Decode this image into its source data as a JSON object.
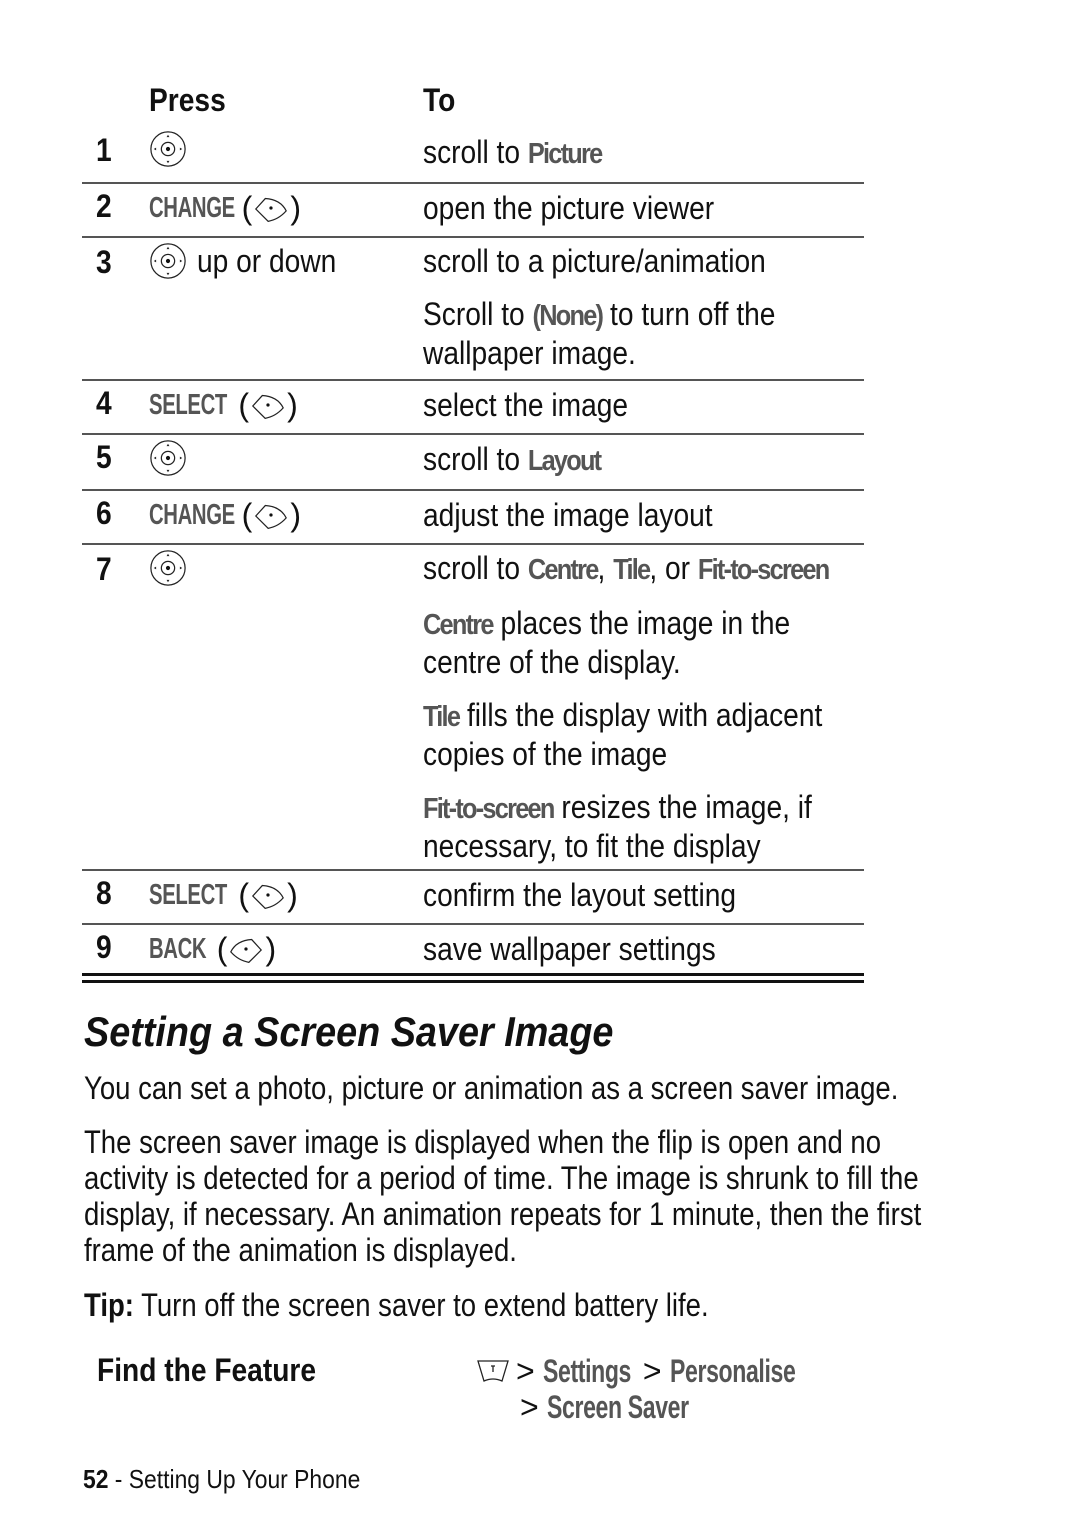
{
  "table": {
    "header": {
      "press": "Press",
      "to": "To"
    },
    "rows": [
      {
        "num": "1",
        "key_icon": "nav-key-icon",
        "key_label": "",
        "key_suffix": "",
        "desc": [
          {
            "text": "scroll to ",
            "menu": "Picture"
          }
        ]
      },
      {
        "num": "2",
        "key_icon": "right-soft-key-icon",
        "key_label": "CHANGE",
        "desc": [
          {
            "text": "open the picture viewer"
          }
        ]
      },
      {
        "num": "3",
        "key_icon": "nav-key-icon",
        "key_suffix": "up or down",
        "desc": [
          {
            "text": "scroll to a picture/animation"
          },
          {
            "pre": "Scroll to ",
            "menu": "(None)",
            "post": " to turn off the wallpaper image."
          }
        ]
      },
      {
        "num": "4",
        "key_icon": "right-soft-key-icon",
        "key_label": "SELECT",
        "desc": [
          {
            "text": "select the image"
          }
        ]
      },
      {
        "num": "5",
        "key_icon": "nav-key-icon",
        "desc": [
          {
            "text": "scroll to ",
            "menu": "Layout"
          }
        ]
      },
      {
        "num": "6",
        "key_icon": "right-soft-key-icon",
        "key_label": "CHANGE",
        "desc": [
          {
            "text": "adjust the image layout"
          }
        ]
      },
      {
        "num": "7",
        "key_icon": "nav-key-icon",
        "desc": [
          {
            "pre": "scroll to ",
            "m1": "Centre",
            "s1": ", ",
            "m2": "Tile",
            "s2": ", or ",
            "m3": "Fit-to-screen"
          },
          {
            "menu": "Centre",
            "post": " places the image in the centre of the display."
          },
          {
            "menu": "Tile",
            "post": " fills the display with adjacent copies of the image"
          },
          {
            "menu": "Fit-to-screen",
            "post": " resizes the image, if necessary, to fit the display"
          }
        ]
      },
      {
        "num": "8",
        "key_icon": "right-soft-key-icon",
        "key_label": "SELECT",
        "desc": [
          {
            "text": "confirm the layout setting"
          }
        ]
      },
      {
        "num": "9",
        "key_icon": "left-soft-key-icon",
        "key_label": "BACK",
        "desc": [
          {
            "text": "save wallpaper settings"
          }
        ]
      }
    ]
  },
  "section": {
    "title": "Setting a Screen Saver Image",
    "intro": "You can set a photo, picture or animation as a screen saver image.",
    "body": "The screen saver image is displayed when the flip is open and no activity is detected for a period of time. The image is shrunk to fill the display, if necessary. An animation repeats for 1 minute, then the first frame of the animation is displayed.",
    "tip_label": "Tip:",
    "tip_text": " Turn off the screen saver to extend battery life."
  },
  "find_feature": {
    "label": "Find the Feature",
    "menu_icon": "menu-key-icon",
    "separator": ">",
    "path": [
      "Settings",
      "Personalise",
      "Screen Saver"
    ]
  },
  "footer": {
    "page_number": "52",
    "separator": " - ",
    "chapter": "Setting Up Your Phone"
  },
  "colors": {
    "text": "#111111",
    "display_text": "#555555",
    "rule": "#555555"
  }
}
